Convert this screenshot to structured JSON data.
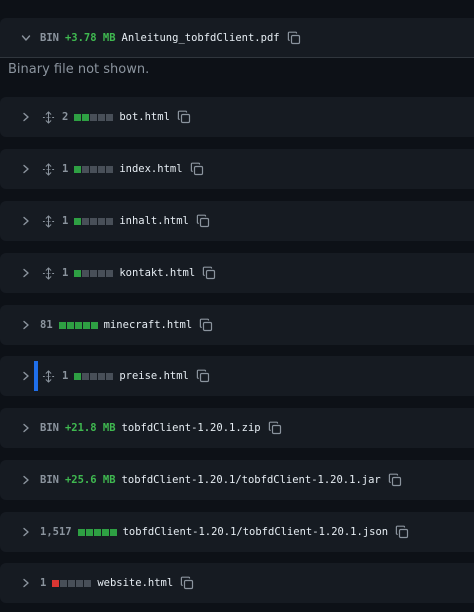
{
  "files": [
    {
      "expanded": true,
      "bin": "BIN",
      "size": "+3.78 MB",
      "name": "Anleitung_tobfdClient.pdf"
    },
    {
      "count": "2",
      "blocks": [
        "g",
        "g",
        "n",
        "n",
        "n"
      ],
      "name": "bot.html",
      "expand_icon": true
    },
    {
      "count": "1",
      "blocks": [
        "g",
        "n",
        "n",
        "n",
        "n"
      ],
      "name": "index.html",
      "expand_icon": true
    },
    {
      "count": "1",
      "blocks": [
        "g",
        "n",
        "n",
        "n",
        "n"
      ],
      "name": "inhalt.html",
      "expand_icon": true
    },
    {
      "count": "1",
      "blocks": [
        "g",
        "n",
        "n",
        "n",
        "n"
      ],
      "name": "kontakt.html",
      "expand_icon": true
    },
    {
      "count": "81",
      "blocks": [
        "g",
        "g",
        "g",
        "g",
        "g"
      ],
      "name": "minecraft.html"
    },
    {
      "count": "1",
      "blocks": [
        "g",
        "n",
        "n",
        "n",
        "n"
      ],
      "name": "preise.html",
      "expand_icon": true,
      "marker": true
    },
    {
      "bin": "BIN",
      "size": "+21.8 MB",
      "name": "tobfdClient-1.20.1.zip"
    },
    {
      "bin": "BIN",
      "size": "+25.6 MB",
      "name": "tobfdClient-1.20.1/tobfdClient-1.20.1.jar"
    },
    {
      "count": "1,517",
      "blocks": [
        "g",
        "g",
        "g",
        "g",
        "g"
      ],
      "name": "tobfdClient-1.20.1/tobfdClient-1.20.1.json"
    },
    {
      "count": "1",
      "blocks": [
        "r",
        "n",
        "n",
        "n",
        "n"
      ],
      "name": "website.html"
    }
  ],
  "binary_note": "Binary file not shown.",
  "colors": {
    "added": "#2ea043",
    "deleted": "#da3633",
    "neutral": "#484f58",
    "size": "#3fb950",
    "marker": "#1f6feb"
  },
  "icons": {
    "collapsed": "chevron-right-icon",
    "expanded": "chevron-down-icon",
    "expand": "unfold-icon",
    "copy": "copy-icon"
  }
}
